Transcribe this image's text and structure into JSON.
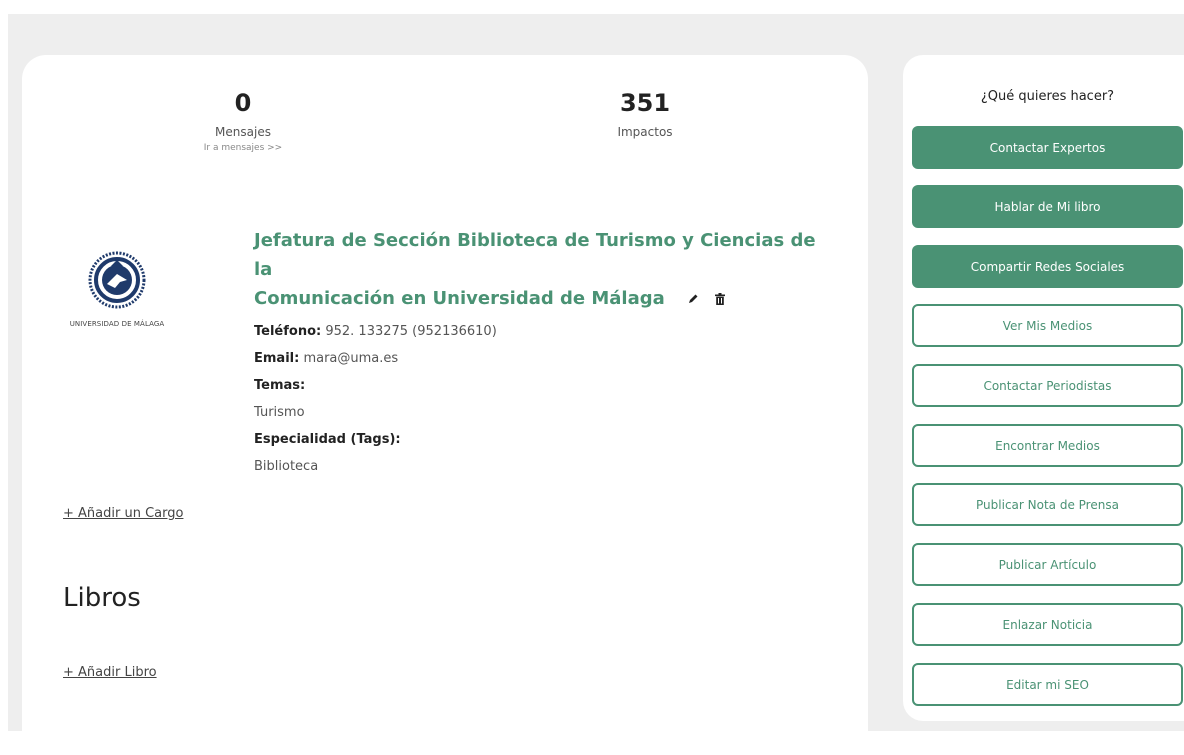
{
  "stats": {
    "messages": {
      "count": "0",
      "label": "Mensajes",
      "link": "Ir a mensajes >>"
    },
    "impacts": {
      "count": "351",
      "label": "Impactos"
    }
  },
  "profile": {
    "logo_caption": "UNIVERSIDAD DE MÁLAGA",
    "title_line1": "Jefatura de Sección Biblioteca de Turismo y Ciencias de la",
    "title_line2": "Comunicación en Universidad de Málaga",
    "phone_label": "Teléfono:",
    "phone_value": "952. 133275 (952136610)",
    "email_label": "Email:",
    "email_value": "mara@uma.es",
    "topics_label": "Temas:",
    "topics_value": "Turismo",
    "tags_label": "Especialidad (Tags):",
    "tags_value": "Biblioteca",
    "edit_icon": "pencil-icon",
    "delete_icon": "trash-icon"
  },
  "add_position": "+ Añadir un Cargo",
  "books": {
    "heading": "Libros",
    "add": "+ Añadir Libro"
  },
  "sidebar": {
    "title": "¿Qué quieres hacer?",
    "buttons": [
      {
        "label": "Contactar Expertos",
        "style": "solid"
      },
      {
        "label": "Hablar de Mi libro",
        "style": "solid"
      },
      {
        "label": "Compartir Redes Sociales",
        "style": "solid"
      },
      {
        "label": "Ver Mis Medios",
        "style": "outline"
      },
      {
        "label": "Contactar Periodistas",
        "style": "outline"
      },
      {
        "label": "Encontrar Medios",
        "style": "outline"
      },
      {
        "label": "Publicar Nota de Prensa",
        "style": "outline"
      },
      {
        "label": "Publicar Artículo",
        "style": "outline"
      },
      {
        "label": "Enlazar Noticia",
        "style": "outline"
      },
      {
        "label": "Editar mi SEO",
        "style": "outline"
      }
    ]
  },
  "colors": {
    "accent": "#4a9274",
    "page_bg": "#eeeeee",
    "logo_blue": "#1f3a6b"
  }
}
